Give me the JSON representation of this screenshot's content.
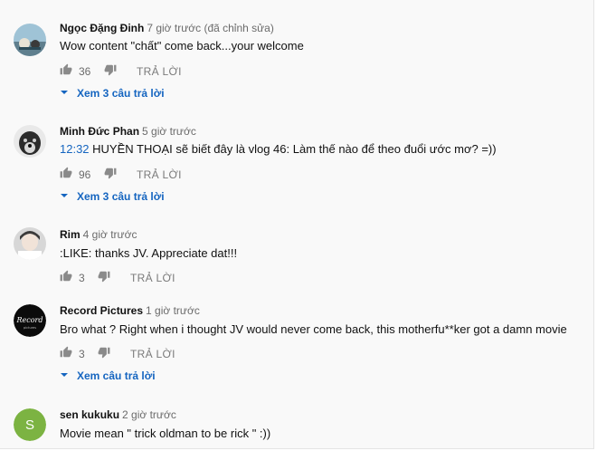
{
  "comments": [
    {
      "author": "Ngọc Đặng Đinh",
      "time": "7 giờ trước (đã chỉnh sửa)",
      "text": "Wow content \"chất\" come back...your welcome",
      "likes": "36",
      "reply_label": "TRẢ LỜI",
      "view_replies": "Xem 3 câu trả lời"
    },
    {
      "author": "Minh Đức Phan",
      "time": "5 giờ trước",
      "timestamp": "12:32",
      "text": " HUYỀN THOẠI sẽ biết đây là vlog 46: Làm thế nào để theo đuổi ước mơ? =))",
      "likes": "96",
      "reply_label": "TRẢ LỜI",
      "view_replies": "Xem 3 câu trả lời"
    },
    {
      "author": "Rim",
      "time": "4 giờ trước",
      "text": ":LIKE: thanks JV. Appreciate dat!!!",
      "likes": "3",
      "reply_label": "TRẢ LỜI"
    },
    {
      "author": "Record Pictures",
      "time": "1 giờ trước",
      "text": "Bro what ? Right when i thought JV would never come back, this motherfu**ker got a damn movie",
      "likes": "3",
      "reply_label": "TRẢ LỜI",
      "view_replies": "Xem câu trả lời"
    },
    {
      "author": "sen kukuku",
      "time": "2 giờ trước",
      "avatar_letter": "S",
      "text": "Movie mean \" trick oldman to be rick \" :))"
    }
  ],
  "colors": {
    "link": "#1565c0",
    "avatar_s": "#7cb342"
  }
}
